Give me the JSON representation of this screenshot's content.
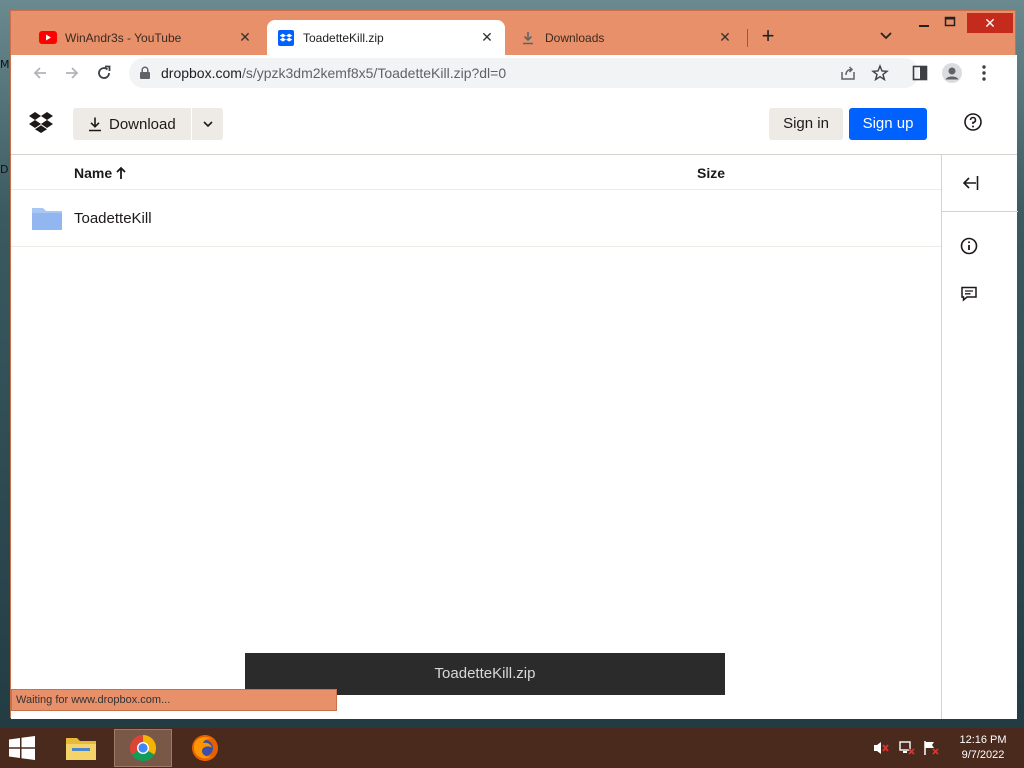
{
  "browser": {
    "tabs": [
      {
        "title": "WinAndr3s - YouTube",
        "icon": "youtube-icon"
      },
      {
        "title": "ToadetteKill.zip",
        "icon": "dropbox-icon",
        "active": true
      },
      {
        "title": "Downloads",
        "icon": "download-icon"
      }
    ],
    "new_tab": "+",
    "url_host": "dropbox.com",
    "url_path": "/s/ypzk3dm2kemf8x5/ToadetteKill.zip?dl=0"
  },
  "header": {
    "download_label": "Download",
    "signin_label": "Sign in",
    "signup_label": "Sign up",
    "accent_color": "#0061fe"
  },
  "filelist": {
    "columns": {
      "name": "Name",
      "size": "Size"
    },
    "rows": [
      {
        "name": "ToadetteKill",
        "type": "folder",
        "size": ""
      }
    ]
  },
  "toast": {
    "text": "ToadetteKill.zip"
  },
  "status": {
    "text": "Waiting for www.dropbox.com..."
  },
  "desktop": {
    "edge_chars": [
      "M",
      "D"
    ]
  },
  "taskbar": {
    "apps": [
      "file-explorer-icon",
      "chrome-icon",
      "firefox-icon"
    ],
    "time": "12:16 PM",
    "date": "9/7/2022"
  }
}
